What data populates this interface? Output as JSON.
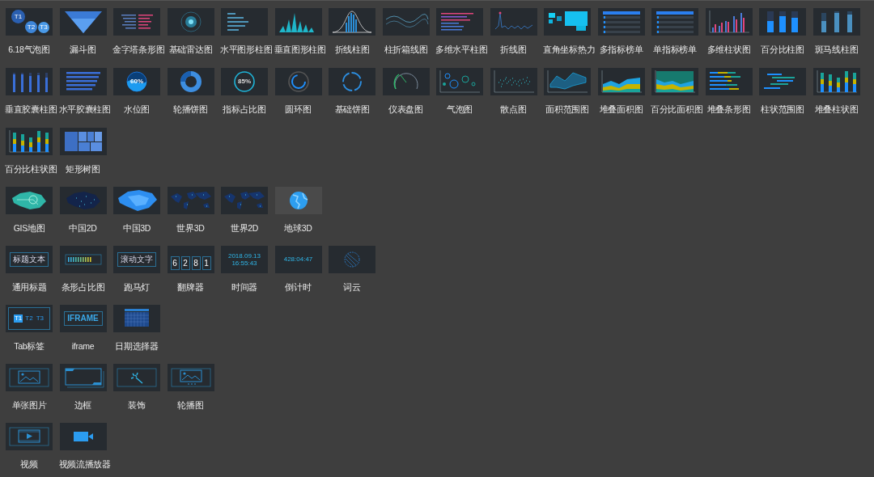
{
  "groups": [
    {
      "tiles": [
        {
          "label": "6.18气泡图",
          "kind": "bubble",
          "preview_text": [
            "T1",
            "T2",
            "T3"
          ],
          "selected": false
        },
        {
          "label": "漏斗图",
          "kind": "funnel",
          "selected": false
        },
        {
          "label": "金字塔条形图",
          "kind": "pyramid",
          "selected": false
        },
        {
          "label": "基础雷达图",
          "kind": "radar",
          "selected": false
        },
        {
          "label": "水平图形柱图",
          "kind": "hbar",
          "selected": false
        },
        {
          "label": "垂直图形柱图",
          "kind": "spikes",
          "selected": false
        },
        {
          "label": "折线柱图",
          "kind": "peak",
          "selected": false
        },
        {
          "label": "柱折箱线图",
          "kind": "lines",
          "selected": false
        },
        {
          "label": "多维水平柱图",
          "kind": "hbar2",
          "selected": false
        },
        {
          "label": "折线图",
          "kind": "line",
          "selected": false
        },
        {
          "label": "直角坐标热力",
          "kind": "heat",
          "selected": false
        },
        {
          "label": "多指标榜单",
          "kind": "table",
          "selected": false
        },
        {
          "label": "单指标榜单",
          "kind": "table",
          "selected": false
        },
        {
          "label": "多维柱状图",
          "kind": "vbars",
          "selected": false
        },
        {
          "label": "百分比柱图",
          "kind": "pctbars",
          "selected": false
        },
        {
          "label": "斑马线柱图",
          "kind": "zebra",
          "selected": false
        },
        {
          "label": "垂直胶囊柱图",
          "kind": "capsv",
          "selected": false
        },
        {
          "label": "水平胶囊柱图",
          "kind": "capsh",
          "selected": false
        },
        {
          "label": "水位图",
          "kind": "water",
          "preview_text": [
            "60%"
          ],
          "selected": false
        },
        {
          "label": "轮播饼图",
          "kind": "donut",
          "selected": false
        },
        {
          "label": "指标占比图",
          "kind": "ring",
          "preview_text": [
            "85%"
          ],
          "selected": false
        },
        {
          "label": "圆环图",
          "kind": "rings",
          "selected": false
        },
        {
          "label": "基础饼图",
          "kind": "thinring",
          "selected": false
        },
        {
          "label": "仪表盘图",
          "kind": "gauge",
          "selected": false
        },
        {
          "label": "气泡图",
          "kind": "scatterbub",
          "selected": false
        },
        {
          "label": "散点图",
          "kind": "scatter",
          "selected": false
        },
        {
          "label": "面积范围图",
          "kind": "arearange",
          "selected": false
        },
        {
          "label": "堆叠面积图",
          "kind": "stackarea",
          "selected": false
        },
        {
          "label": "百分比面积图",
          "kind": "pctarea",
          "selected": false
        },
        {
          "label": "堆叠条形图",
          "kind": "stackh",
          "selected": false
        },
        {
          "label": "柱状范围图",
          "kind": "rangeh",
          "selected": false
        },
        {
          "label": "堆叠柱状图",
          "kind": "stackv",
          "selected": false
        },
        {
          "label": "百分比柱状图",
          "kind": "stackv",
          "selected": false
        },
        {
          "label": "矩形树图",
          "kind": "treemap",
          "selected": false
        }
      ]
    },
    {
      "tiles": [
        {
          "label": "GIS地图",
          "kind": "map",
          "selected": false
        },
        {
          "label": "中国2D",
          "kind": "mapdark",
          "selected": false
        },
        {
          "label": "中国3D",
          "kind": "map3d",
          "selected": false
        },
        {
          "label": "世界3D",
          "kind": "world",
          "selected": false
        },
        {
          "label": "世界2D",
          "kind": "world",
          "selected": false
        },
        {
          "label": "地球3D",
          "kind": "globe",
          "selected": true
        }
      ]
    },
    {
      "tiles": [
        {
          "label": "通用标题",
          "kind": "textbox",
          "preview_text": [
            "标题文本"
          ],
          "selected": false
        },
        {
          "label": "条形占比图",
          "kind": "segbar",
          "selected": false
        },
        {
          "label": "跑马灯",
          "kind": "textbox",
          "preview_text": [
            "滚动文字"
          ],
          "selected": false
        },
        {
          "label": "翻牌器",
          "kind": "flip",
          "preview_text": [
            "6",
            "2",
            "8",
            "1"
          ],
          "selected": false
        },
        {
          "label": "时间器",
          "kind": "clock",
          "preview_text": [
            "2018.09.13 16:55:43"
          ],
          "selected": false
        },
        {
          "label": "倒计时",
          "kind": "countdown",
          "preview_text": [
            "428:04:47"
          ],
          "selected": false
        },
        {
          "label": "词云",
          "kind": "cloud",
          "selected": false
        }
      ]
    },
    {
      "tiles": [
        {
          "label": "Tab标签",
          "kind": "tabs",
          "preview_text": [
            "T1",
            "T2",
            "T3"
          ],
          "selected": false
        },
        {
          "label": "iframe",
          "kind": "iframe",
          "preview_text": [
            "IFRAME"
          ],
          "selected": false
        },
        {
          "label": "日期选择器",
          "kind": "calendar",
          "selected": false
        }
      ]
    },
    {
      "tiles": [
        {
          "label": "单张图片",
          "kind": "image",
          "selected": false
        },
        {
          "label": "边框",
          "kind": "border",
          "selected": false
        },
        {
          "label": "装饰",
          "kind": "wand",
          "selected": false
        },
        {
          "label": "轮播图",
          "kind": "carousel",
          "selected": false
        }
      ]
    },
    {
      "tiles": [
        {
          "label": "视频",
          "kind": "video",
          "selected": false
        },
        {
          "label": "视频流播放器",
          "kind": "camera",
          "selected": false
        }
      ]
    }
  ]
}
